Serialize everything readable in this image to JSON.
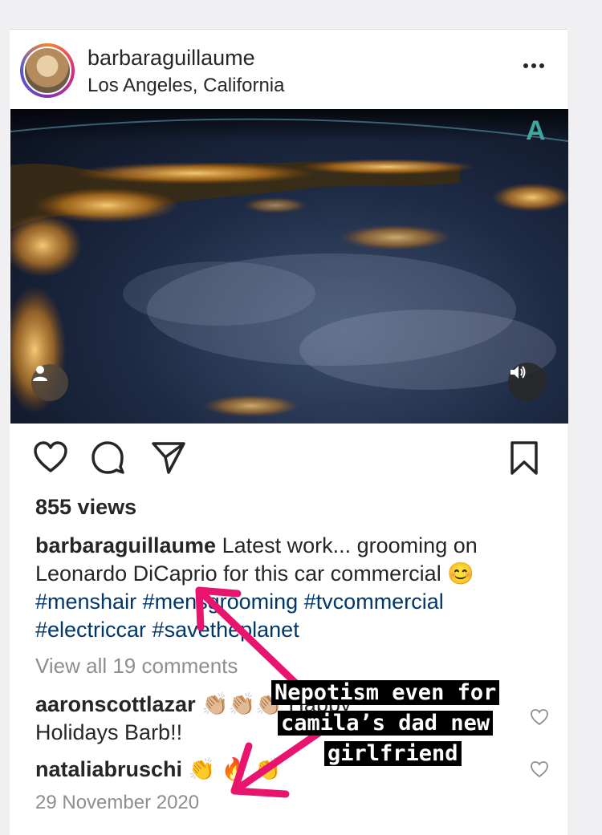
{
  "post": {
    "username": "barbaraguillaume",
    "location": "Los Angeles, California",
    "more_icon": "more-horizontal-icon",
    "views": "855 views",
    "caption_user": "barbaraguillaume",
    "caption_line1": " Latest work... grooming on",
    "caption_line2": "Leonardo DiCaprio for this car commercial 😊",
    "hashtags_line1": "#menshair #mensgrooming #tvcommercial",
    "hashtags_line2": "#electriccar #savetheplanet",
    "view_all_comments": "View all 19 comments",
    "date": "29 November 2020",
    "watermark": "A"
  },
  "comments": [
    {
      "user": "aaronscottlazar",
      "text": " 👏🏼👏🏼👏🏼 Happy",
      "line2": "Holidays Barb!!"
    },
    {
      "user": "nataliabruschi",
      "text": " 👏 🔥 👏"
    }
  ],
  "overlay": {
    "line1": "Nepotism even for",
    "line2": "camila’s dad new",
    "line3": "girlfriend",
    "arrow_color": "#e8146e"
  },
  "icons": [
    "like-icon",
    "comment-icon",
    "share-icon",
    "save-icon",
    "sound-icon",
    "user-tag-icon"
  ]
}
